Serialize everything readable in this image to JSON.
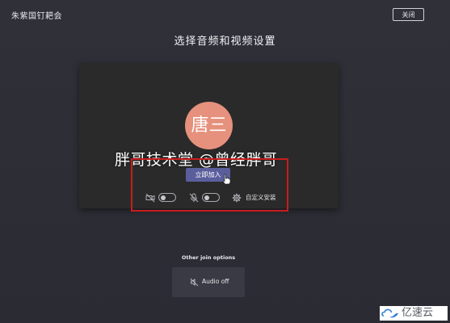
{
  "window": {
    "meeting_title": "朱紫国钉耙会",
    "close_label": "关闭"
  },
  "main": {
    "heading": "选择音频和视频设置"
  },
  "preview": {
    "avatar_text": "唐三",
    "watermark_text": "胖哥技术堂 @曾经胖哥",
    "join_label": "立即加入",
    "camera_toggle": "off",
    "mic_toggle": "off",
    "device_settings_label": "自定义安装"
  },
  "other_options": {
    "title": "Other join options",
    "audio_off_label": "Audio off"
  },
  "brand": {
    "text": "亿速云"
  },
  "colors": {
    "background": "#2f2f38",
    "avatar": "#e6917d",
    "join_button": "#5b5e9c",
    "highlight": "#c81d1d"
  },
  "icons": {
    "camera": "camera-off-icon",
    "mic": "mic-off-icon",
    "settings": "gear-icon",
    "audio_off": "speaker-off-icon",
    "cursor": "hand-cursor-icon"
  }
}
